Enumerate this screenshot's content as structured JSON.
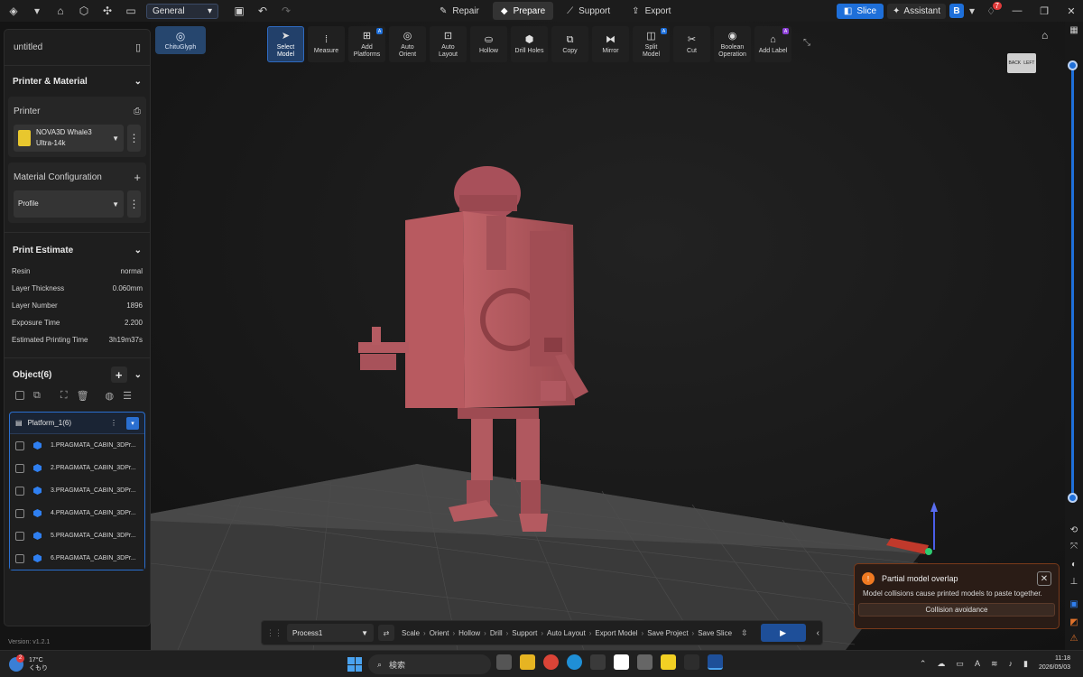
{
  "titlebar": {
    "workspace_select": "General",
    "tabs": [
      {
        "label": "Repair",
        "icon": "repair-icon"
      },
      {
        "label": "Prepare",
        "icon": "prepare-icon"
      },
      {
        "label": "Support",
        "icon": "support-icon"
      },
      {
        "label": "Export",
        "icon": "export-icon"
      }
    ],
    "active_tab": "Prepare",
    "slice_label": "Slice",
    "assistant_label": "Assistant",
    "user_initial": "B",
    "notification_count": "7"
  },
  "left_panel": {
    "project_name": "untitled",
    "printer_material": {
      "title": "Printer & Material",
      "printer_label": "Printer",
      "printer_name": "NOVA3D Whale3",
      "printer_model": "Ultra-14k",
      "material_label": "Material Configuration",
      "profile_value": "Profile"
    },
    "print_estimate": {
      "title": "Print Estimate",
      "rows": [
        {
          "label": "Resin",
          "value": "normal"
        },
        {
          "label": "Layer Thickness",
          "value": "0.060mm"
        },
        {
          "label": "Layer Number",
          "value": "1896"
        },
        {
          "label": "Exposure Time",
          "value": "2.200"
        },
        {
          "label": "Estimated Printing Time",
          "value": "3h19m37s"
        }
      ]
    },
    "objects": {
      "title": "Object(6)",
      "platform_name": "Platform_1(6)",
      "items": [
        "1.PRAGMATA_CABIN_3DPr...",
        "2.PRAGMATA_CABIN_3DPr...",
        "3.PRAGMATA_CABIN_3DPr...",
        "4.PRAGMATA_CABIN_3DPr...",
        "5.PRAGMATA_CABIN_3DPr...",
        "6.PRAGMATA_CABIN_3DPr..."
      ]
    },
    "version": "Version: v1.2.1"
  },
  "toolbar": {
    "brand": "ChituGlyph",
    "tools": [
      {
        "label1": "Select",
        "label2": "Model",
        "icon": "cursor-icon",
        "ai": false
      },
      {
        "label1": "Measure",
        "label2": "",
        "icon": "ruler-icon",
        "ai": false
      },
      {
        "label1": "Add",
        "label2": "Platforms",
        "icon": "add-platform-icon",
        "ai": true
      },
      {
        "label1": "Auto",
        "label2": "Orient",
        "icon": "orient-icon",
        "ai": false
      },
      {
        "label1": "Auto",
        "label2": "Layout",
        "icon": "layout-icon",
        "ai": false
      },
      {
        "label1": "Hollow",
        "label2": "",
        "icon": "hollow-icon",
        "ai": false
      },
      {
        "label1": "Drill Holes",
        "label2": "",
        "icon": "drill-icon",
        "ai": false
      },
      {
        "label1": "Copy",
        "label2": "",
        "icon": "copy-icon",
        "ai": false
      },
      {
        "label1": "Mirror",
        "label2": "",
        "icon": "mirror-icon",
        "ai": false
      },
      {
        "label1": "Split",
        "label2": "Model",
        "icon": "split-icon",
        "ai": true
      },
      {
        "label1": "Cut",
        "label2": "",
        "icon": "cut-icon",
        "ai": false
      },
      {
        "label1": "Boolean",
        "label2": "Operation",
        "icon": "boolean-icon",
        "ai": false
      },
      {
        "label1": "Add Label",
        "label2": "",
        "icon": "label-icon",
        "ai": true
      }
    ]
  },
  "view_cube": {
    "left": "BACK",
    "right": "LEFT"
  },
  "toast": {
    "title": "Partial model overlap",
    "message": "Model collisions cause printed models to paste together.",
    "button": "Collision avoidance"
  },
  "bottom_bar": {
    "process": "Process1",
    "steps": [
      "Scale",
      "Orient",
      "Hollow",
      "Drill",
      "Support",
      "Auto Layout",
      "Export Model",
      "Save Project",
      "Save Slice"
    ]
  },
  "taskbar": {
    "temperature": "17°C",
    "weather": "くもり",
    "weather_badge": "2",
    "search_placeholder": "検索",
    "time": "11:18",
    "date": "2026/05/03"
  },
  "colors": {
    "accent": "#1e6fd9",
    "model": "#b45a5e",
    "warning": "#f07a22"
  }
}
